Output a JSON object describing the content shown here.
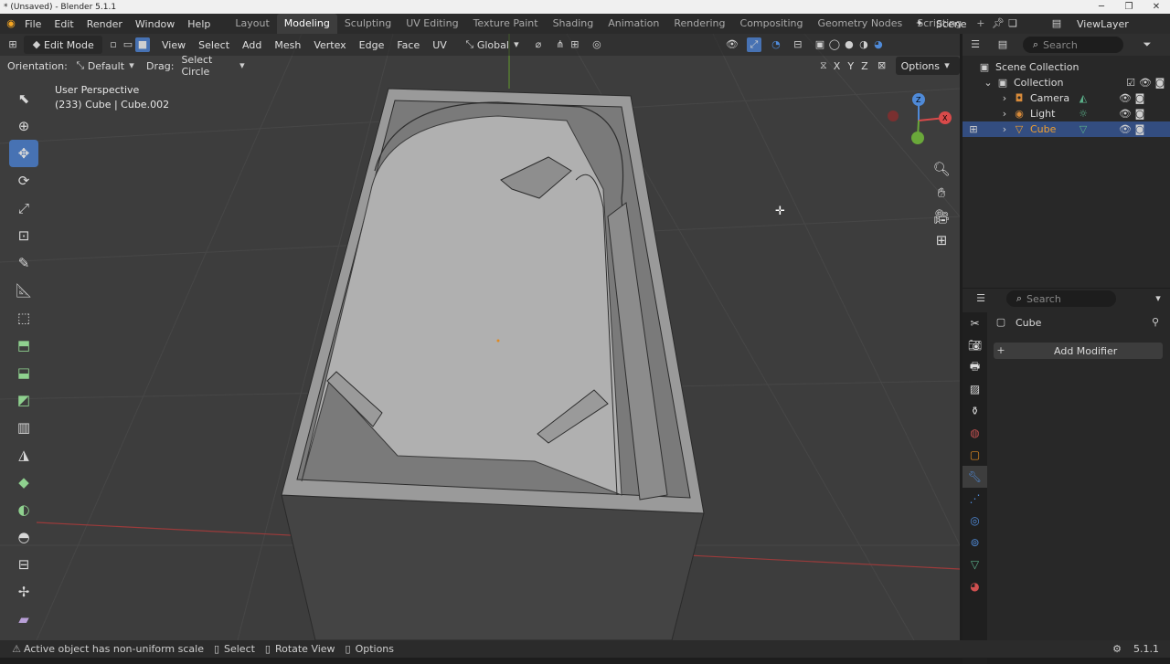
{
  "window": {
    "title": "* (Unsaved) - Blender 5.1.1"
  },
  "menu": {
    "file": "File",
    "edit": "Edit",
    "render": "Render",
    "window": "Window",
    "help": "Help"
  },
  "workspaces": [
    "Layout",
    "Modeling",
    "Sculpting",
    "UV Editing",
    "Texture Paint",
    "Shading",
    "Animation",
    "Rendering",
    "Compositing",
    "Geometry Nodes",
    "Scripting"
  ],
  "active_workspace": "Modeling",
  "scene": {
    "name": "Scene",
    "view_layer": "ViewLayer"
  },
  "viewport_header": {
    "mode": "Edit Mode",
    "view": "View",
    "select": "Select",
    "add": "Add",
    "mesh": "Mesh",
    "vertex": "Vertex",
    "edge": "Edge",
    "face": "Face",
    "uv": "UV",
    "transform_orientation": "Global"
  },
  "tool_settings": {
    "orientation_label": "Orientation:",
    "orientation_value": "Default",
    "drag_label": "Drag:",
    "drag_value": "Select Circle",
    "axes": [
      "X",
      "Y",
      "Z"
    ],
    "options": "Options"
  },
  "viewport_info": {
    "perspective": "User Perspective",
    "object_info": "(233) Cube | Cube.002"
  },
  "toolbar_tools": [
    "select-box",
    "cursor",
    "move",
    "rotate",
    "scale",
    "transform",
    "annotate",
    "measure",
    "add-cube",
    "extrude-region",
    "inset-faces",
    "bevel",
    "loop-cut",
    "knife",
    "poly-build",
    "spin",
    "smooth",
    "edge-slide",
    "shrink-fatten",
    "shear"
  ],
  "outliner": {
    "search_placeholder": "Search",
    "scene_collection": "Scene Collection",
    "collection": "Collection",
    "items": [
      "Camera",
      "Light",
      "Cube"
    ],
    "selected": "Cube"
  },
  "properties": {
    "search_placeholder": "Search",
    "object_name": "Cube",
    "add_modifier": "Add Modifier",
    "active_tab": "modifier"
  },
  "status_bar": {
    "warning": "Active object has non-uniform scale",
    "select": "Select",
    "rotate_view": "Rotate View",
    "options": "Options",
    "version": "5.1.1"
  },
  "colors": {
    "accent": "#4772b3",
    "background": "#3d3d3d",
    "panel": "#282828"
  }
}
